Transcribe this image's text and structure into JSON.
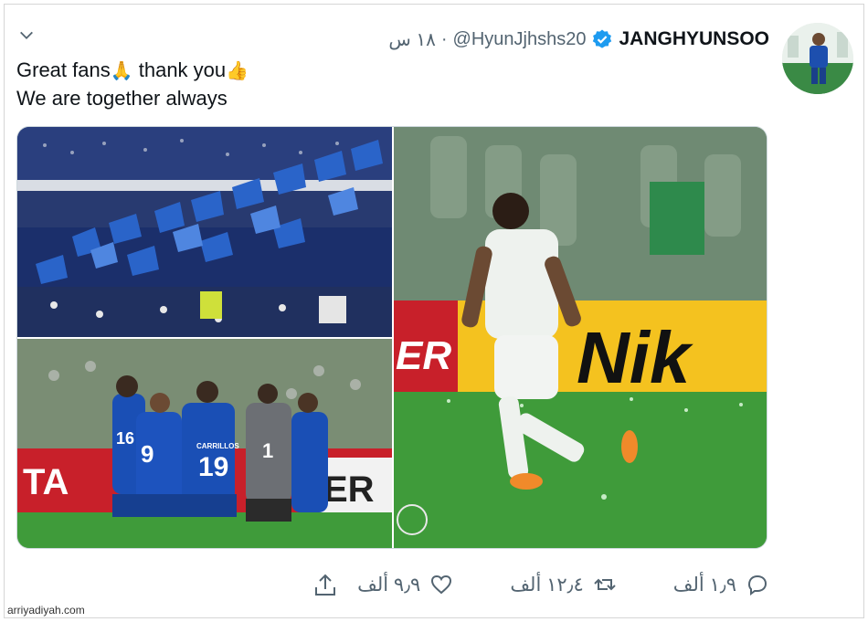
{
  "tweet": {
    "display_name": "JANGHYUNSOO",
    "handle": "@HyunJjhshs20",
    "separator": "·",
    "time": "١٨ س",
    "text_line1": "Great fans",
    "emoji1": "🙏",
    "text_line1b": " thank you",
    "emoji2": "👍",
    "text_line2": "We are together always"
  },
  "photos": {
    "photo1": {
      "desc_icon": "fans-with-flags-photo"
    },
    "photo2": {
      "jersey_numbers": [
        "9",
        "19",
        "1",
        "16"
      ],
      "jersey_name": "CARRILLOS",
      "ad_text": "ER",
      "ad_text2": "TA"
    },
    "photo3": {
      "ad_text": "Nik",
      "ad_text2": "ER"
    }
  },
  "actions": {
    "reply_count": "١٫٩ ألف",
    "retweet_count": "١٢٫٤ ألف",
    "like_count": "٩٫٩ ألف"
  },
  "colors": {
    "verified": "#1d9bf0",
    "muted": "#536471",
    "text": "#0f1419",
    "hilal_blue": "#1a4fb5",
    "pitch_green": "#3f9b3a"
  },
  "watermark": "arriyadiyah.com"
}
